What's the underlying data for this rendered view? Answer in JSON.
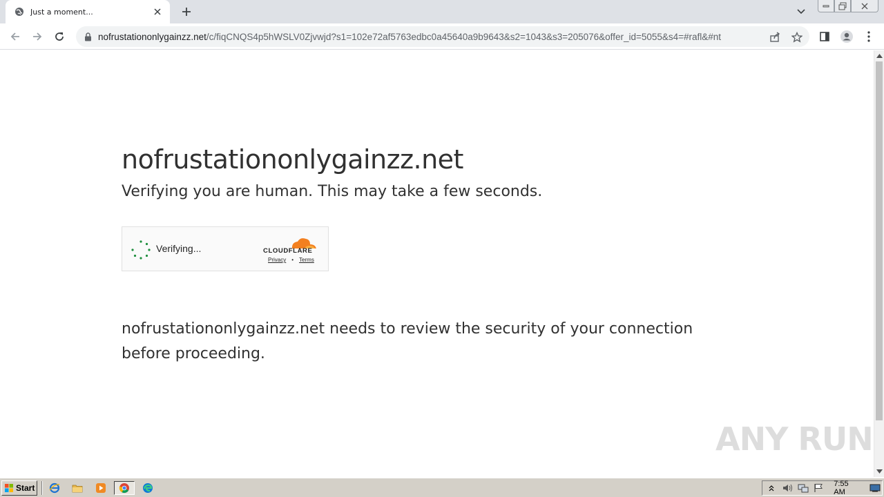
{
  "browser": {
    "tab": {
      "title": "Just a moment...",
      "favicon": "globe-icon"
    },
    "address": {
      "host": "nofrustationonlygainzz.net",
      "path": "/c/fiqCNQS4p5hWSLV0Zjvwjd?s1=102e72af5763edbc0a45640a9b9643&s2=1043&s3=205076&offer_id=5055&s4=#rafl&#nt"
    }
  },
  "page": {
    "heading": "nofrustationonlygainzz.net",
    "subheading": "Verifying you are human. This may take a few seconds.",
    "widget": {
      "status": "Verifying...",
      "brand": "CLOUDFLARE",
      "privacy": "Privacy",
      "separator": "•",
      "terms": "Terms"
    },
    "body": "nofrustationonlygainzz.net needs to review the security of your connection before proceeding."
  },
  "watermark": "ANY RUN",
  "taskbar": {
    "start_label": "Start",
    "clock": "7:55 AM"
  },
  "colors": {
    "cloudflare_orange": "#f38020",
    "spinner_green": "#1e8e3e",
    "text": "#313131"
  }
}
